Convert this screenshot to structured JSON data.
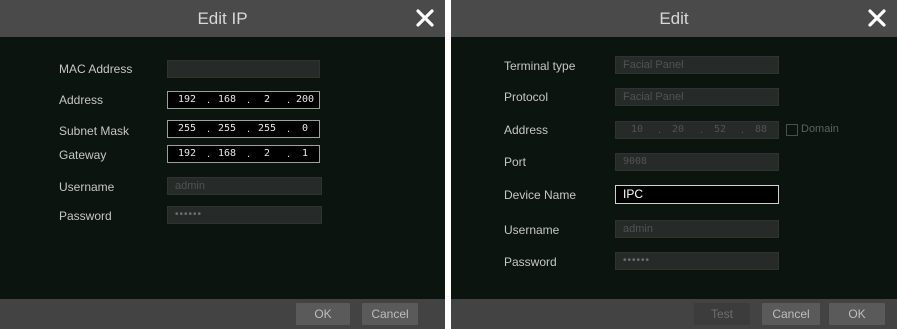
{
  "left_dialog": {
    "title": "Edit IP",
    "fields": {
      "mac_label": "MAC Address",
      "mac_value": "",
      "address_label": "Address",
      "address": [
        "192",
        "168",
        "2",
        "200"
      ],
      "subnet_label": "Subnet Mask",
      "subnet": [
        "255",
        "255",
        "255",
        "0"
      ],
      "gateway_label": "Gateway",
      "gateway": [
        "192",
        "168",
        "2",
        "1"
      ],
      "username_label": "Username",
      "username_value": "admin",
      "password_label": "Password",
      "password_value": "••••••"
    },
    "buttons": {
      "ok": "OK",
      "cancel": "Cancel"
    }
  },
  "right_dialog": {
    "title": "Edit",
    "fields": {
      "terminal_label": "Terminal type",
      "terminal_value": "Facial Panel",
      "protocol_label": "Protocol",
      "protocol_value": "Facial Panel",
      "address_label": "Address",
      "address": [
        "10",
        "20",
        "52",
        "88"
      ],
      "domain_label": "Domain",
      "port_label": "Port",
      "port_value": "9008",
      "device_name_label": "Device Name",
      "device_name_value": "IPC",
      "username_label": "Username",
      "username_value": "admin",
      "password_label": "Password",
      "password_value": "••••••"
    },
    "buttons": {
      "test": "Test",
      "cancel": "Cancel",
      "ok": "OK"
    }
  },
  "icons": {
    "close": "close-icon"
  },
  "colors": {
    "dialog_bg": "#0c1410",
    "titlebar_bg": "#4a4a4a",
    "footer_bg": "#434343",
    "field_bg": "#262a28",
    "button_bg": "#5a5a5a"
  }
}
